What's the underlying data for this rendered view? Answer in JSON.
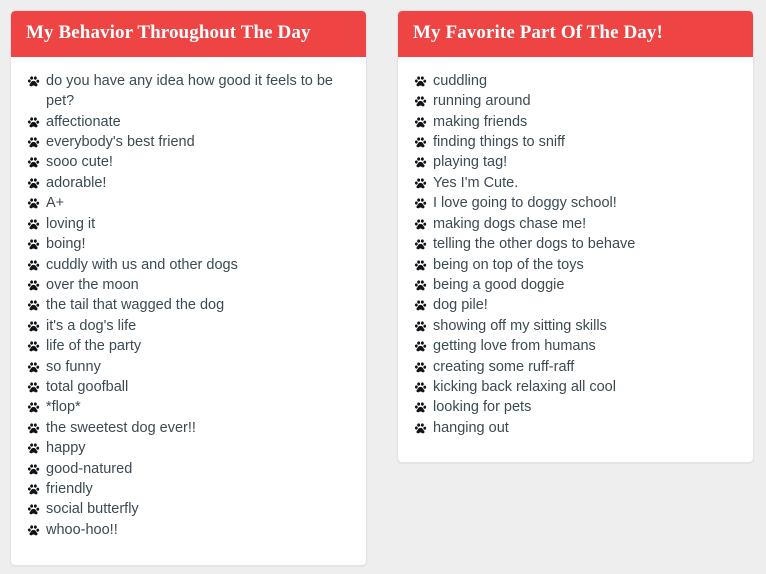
{
  "background_color": "#eeeeee",
  "accent_color": "#ef4444",
  "text_color": "#3c4a52",
  "panels": [
    {
      "id": "behavior",
      "title": "My Behavior Throughout The Day",
      "bullet_icon": "paw-icon",
      "items": [
        "do you have any idea how good it feels to be pet?",
        "affectionate",
        "everybody's best friend",
        "sooo cute!",
        "adorable!",
        "A+",
        "loving it",
        "boing!",
        "cuddly with us and other dogs",
        "over the moon",
        "the tail that wagged the dog",
        "it's a dog's life",
        "life of the party",
        "so funny",
        "total goofball",
        "*flop*",
        "the sweetest dog ever!!",
        "happy",
        "good-natured",
        "friendly",
        "social butterfly",
        "whoo-hoo!!"
      ]
    },
    {
      "id": "favorite",
      "title": "My Favorite Part Of The Day!",
      "bullet_icon": "paw-icon",
      "items": [
        "cuddling",
        "running around",
        "making friends",
        "finding things to sniff",
        "playing tag!",
        "Yes I'm Cute.",
        "I love going to doggy school!",
        "making dogs chase me!",
        "telling the other dogs to behave",
        "being on top of the toys",
        "being a good doggie",
        "dog pile!",
        "showing off my sitting skills",
        "getting love from humans",
        "creating some ruff-raff",
        "kicking back relaxing all cool",
        "looking for pets",
        "hanging out"
      ]
    }
  ]
}
